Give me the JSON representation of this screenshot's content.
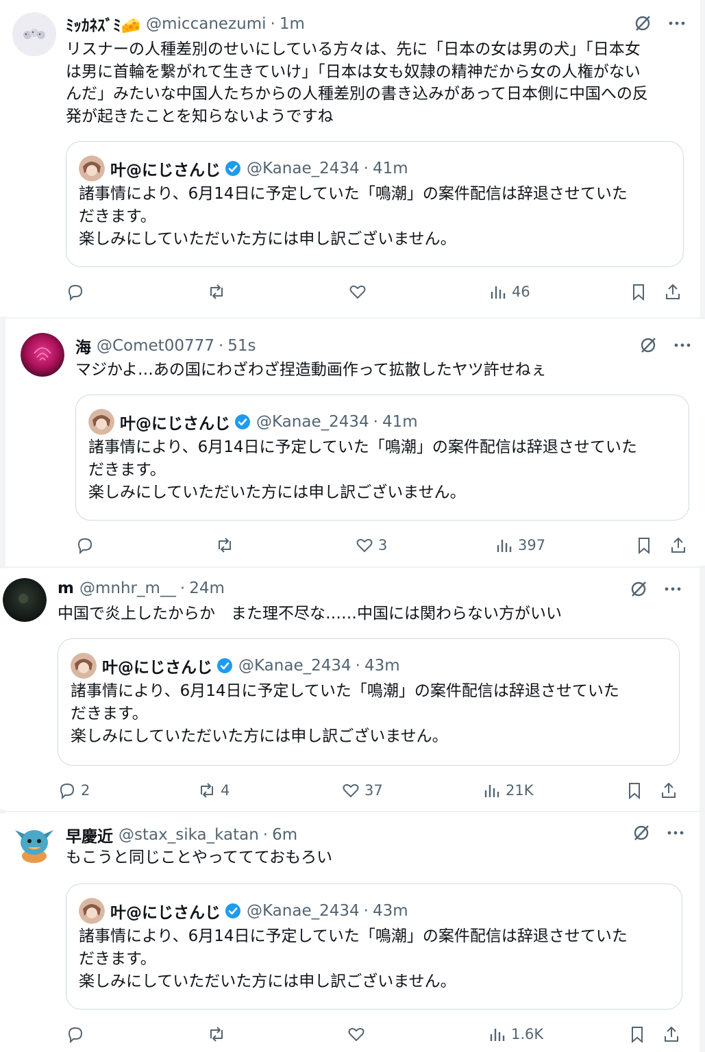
{
  "quote": {
    "name": "叶@にじさんじ",
    "handle": "@Kanae_2434",
    "text": "諸事情により、6月14日に予定していた「鳴潮」の案件配信は辞退させていた\nだきます。\n楽しみにしていただいた方には申し訳ございません。"
  },
  "posts": [
    {
      "name": "ﾐｯｶﾈｽﾞﾐ🧀",
      "handle": "@miccanezumi",
      "time": "1m",
      "text": "リスナーの人種差別のせいにしている方々は、先に「日本の女は男の犬」「日本女\nは男に首輪を繋がれて生きていけ」「日本は女も奴隷の精神だから女の人権がない\nんだ」みたいな中国人たちからの人種差別の書き込みがあって日本側に中国への反\n発が起きたことを知らないようですね",
      "quote_time": "41m",
      "replies": "",
      "reposts": "",
      "likes": "",
      "views": "46"
    },
    {
      "name": "海",
      "handle": "@Comet00777",
      "time": "51s",
      "text": "マジかよ…あの国にわざわざ捏造動画作って拡散したヤツ許せねぇ",
      "quote_time": "41m",
      "replies": "",
      "reposts": "",
      "likes": "3",
      "views": "397"
    },
    {
      "name": "m",
      "handle": "@mnhr_m__",
      "time": "24m",
      "text": "中国で炎上したからか　また理不尽な……中国には関わらない方がいい",
      "quote_time": "43m",
      "replies": "2",
      "reposts": "4",
      "likes": "37",
      "views": "21K"
    },
    {
      "name": "早慶近",
      "handle": "@stax_sika_katan",
      "time": "6m",
      "text": "もこうと同じことやっててておもろい",
      "quote_time": "43m",
      "replies": "",
      "reposts": "",
      "likes": "",
      "views": "1.6K"
    }
  ],
  "colors": {
    "text": "#0f1419",
    "muted": "#536471",
    "border": "#cfd9de",
    "verified": "#1d9bf0"
  }
}
